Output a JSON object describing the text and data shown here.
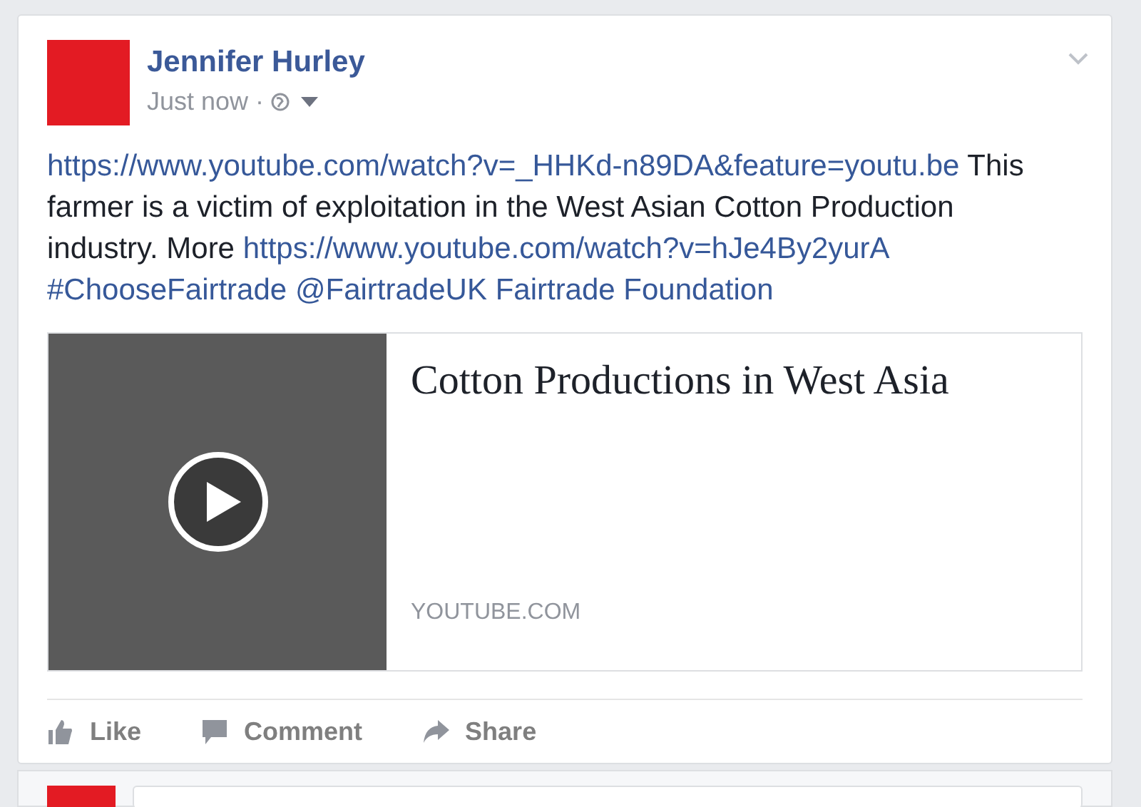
{
  "post": {
    "author": "Jennifer Hurley",
    "time": "Just now",
    "separator": "·",
    "body": [
      {
        "kind": "link",
        "text": "https://www.youtube.com/watch?v=_HHKd-n89DA&feature=youtu.be"
      },
      {
        "kind": "text",
        "text": " This farmer is a victim of exploitation in the West Asian Cotton Production industry. More "
      },
      {
        "kind": "link",
        "text": "https://www.youtube.com/watch?v=hJe4By2yurA"
      },
      {
        "kind": "link",
        "text": "#ChooseFairtrade"
      },
      {
        "kind": "link",
        "text": "@FairtradeUK"
      },
      {
        "kind": "link",
        "text": "Fairtrade Foundation"
      }
    ],
    "attachment": {
      "title": "Cotton Productions in West Asia",
      "domain": "YOUTUBE.COM"
    },
    "actions": [
      {
        "kind": "like",
        "label": "Like"
      },
      {
        "kind": "comment",
        "label": "Comment"
      },
      {
        "kind": "share",
        "label": "Share"
      }
    ]
  }
}
